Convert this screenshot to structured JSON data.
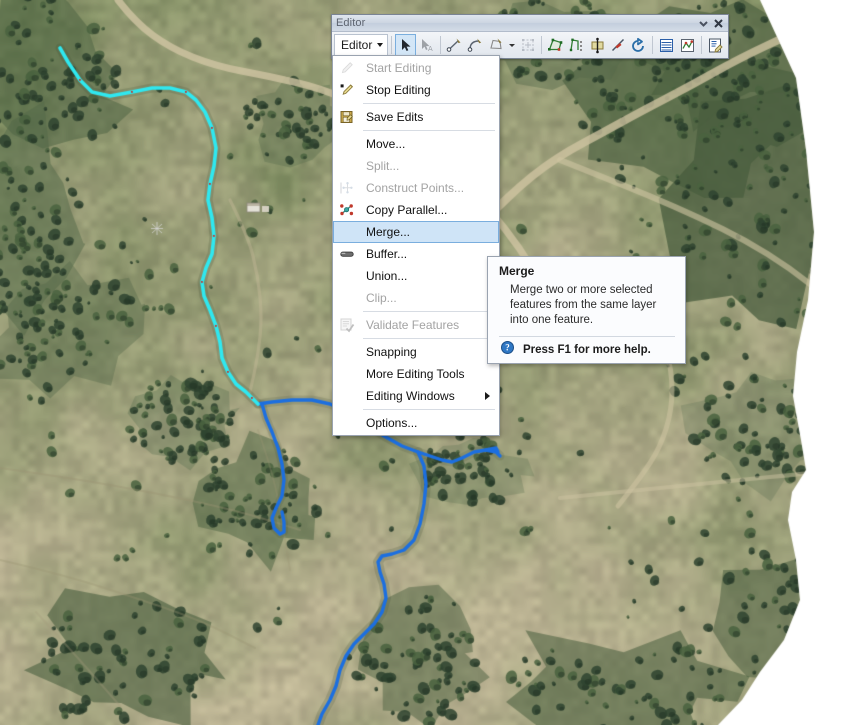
{
  "window": {
    "title": "Editor",
    "collapse_icon": "chevron-down-icon",
    "close_icon": "close-icon"
  },
  "toolbar": {
    "menu_button_label": "Editor",
    "menu_button_caret": "caret-down-icon",
    "buttons": [
      {
        "name": "edit-tool-icon",
        "state": "selected"
      },
      {
        "name": "edit-annotation-tool-icon",
        "state": "disabled"
      },
      {
        "name": "straight-segment-icon",
        "state": "normal"
      },
      {
        "name": "end-point-arc-segment-icon",
        "state": "normal"
      },
      {
        "name": "trace-icon",
        "state": "normal"
      },
      {
        "name": "construction-tools-icon",
        "state": "disabled"
      },
      {
        "name": "edit-vertices-icon",
        "state": "normal"
      },
      {
        "name": "reshape-feature-icon",
        "state": "normal"
      },
      {
        "name": "mirror-features-icon",
        "state": "normal"
      },
      {
        "name": "split-tool-icon",
        "state": "normal"
      },
      {
        "name": "rotate-tool-icon",
        "state": "normal"
      },
      {
        "name": "attributes-icon",
        "state": "normal"
      },
      {
        "name": "sketch-properties-icon",
        "state": "normal"
      },
      {
        "name": "create-features-icon",
        "state": "normal"
      }
    ]
  },
  "menu": {
    "items": [
      {
        "label": "Start Editing",
        "icon": "pencil-start-icon",
        "disabled": true,
        "highlighted": false,
        "submenu": false,
        "separator_after": false
      },
      {
        "label": "Stop Editing",
        "icon": "pencil-stop-icon",
        "disabled": false,
        "highlighted": false,
        "submenu": false,
        "separator_after": true
      },
      {
        "label": "Save Edits",
        "icon": "save-edits-icon",
        "disabled": false,
        "highlighted": false,
        "submenu": false,
        "separator_after": true
      },
      {
        "label": "Move...",
        "icon": "none",
        "disabled": false,
        "highlighted": false,
        "submenu": false,
        "separator_after": false
      },
      {
        "label": "Split...",
        "icon": "none",
        "disabled": true,
        "highlighted": false,
        "submenu": false,
        "separator_after": false
      },
      {
        "label": "Construct Points...",
        "icon": "construct-points-icon",
        "disabled": true,
        "highlighted": false,
        "submenu": false,
        "separator_after": false
      },
      {
        "label": "Copy Parallel...",
        "icon": "copy-parallel-icon",
        "disabled": false,
        "highlighted": false,
        "submenu": false,
        "separator_after": false
      },
      {
        "label": "Merge...",
        "icon": "none",
        "disabled": false,
        "highlighted": true,
        "submenu": false,
        "separator_after": false
      },
      {
        "label": "Buffer...",
        "icon": "buffer-icon",
        "disabled": false,
        "highlighted": false,
        "submenu": false,
        "separator_after": false
      },
      {
        "label": "Union...",
        "icon": "none",
        "disabled": false,
        "highlighted": false,
        "submenu": false,
        "separator_after": false
      },
      {
        "label": "Clip...",
        "icon": "none",
        "disabled": true,
        "highlighted": false,
        "submenu": false,
        "separator_after": true
      },
      {
        "label": "Validate Features",
        "icon": "validate-features-icon",
        "disabled": true,
        "highlighted": false,
        "submenu": false,
        "separator_after": true
      },
      {
        "label": "Snapping",
        "icon": "none",
        "disabled": false,
        "highlighted": false,
        "submenu": false,
        "separator_after": false
      },
      {
        "label": "More Editing Tools",
        "icon": "none",
        "disabled": false,
        "highlighted": false,
        "submenu": false,
        "separator_after": false
      },
      {
        "label": "Editing Windows",
        "icon": "none",
        "disabled": false,
        "highlighted": false,
        "submenu": true,
        "separator_after": true
      },
      {
        "label": "Options...",
        "icon": "none",
        "disabled": false,
        "highlighted": false,
        "submenu": false,
        "separator_after": false
      }
    ]
  },
  "tooltip": {
    "title": "Merge",
    "body": "Merge two or more selected features from the same layer into one feature.",
    "footer": "Press F1 for more help.",
    "footer_icon": "help-circle-icon"
  },
  "map": {
    "selected_stream_color": "#2FE8F0",
    "stream_color": "#1C6FE0",
    "vertex_color": "#C8322D",
    "background_color": "#ffffff",
    "layer_description": "aerial-orthophoto-with-stream-network"
  }
}
